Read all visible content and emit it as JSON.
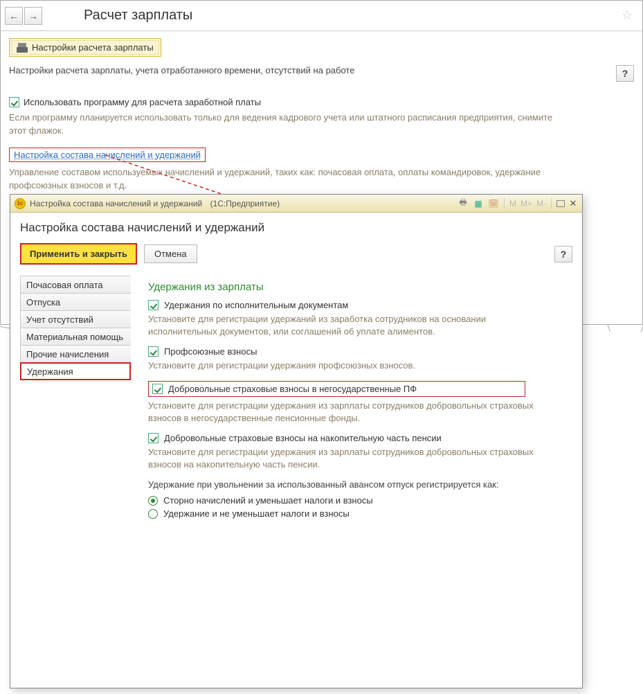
{
  "parent": {
    "title": "Расчет зарплаты",
    "print_button": "Настройки расчета зарплаты",
    "subtitle": "Настройки расчета зарплаты, учета отработанного времени, отсутствий на работе",
    "help": "?",
    "check1": "Использовать программу для расчета заработной платы",
    "hint1": "Если программу планируется использовать только для ведения кадрового учета или штатного расписания предприятия, снимите этот флажок.",
    "link": "Настройка состава начислений и удержаний",
    "hint2": "Управление составом используемых начислений и удержаний, таких как: почасовая оплата, оплаты командировок, удержание профсоюзных взносов и т.д."
  },
  "modal": {
    "window_title_prefix": "Настройка состава начислений и удержаний",
    "window_title_suffix": "(1С:Предприятие)",
    "heading": "Настройка состава начислений и удержаний",
    "apply": "Применить и закрыть",
    "cancel": "Отмена",
    "help": "?",
    "tb": {
      "m": "M",
      "mplus": "M+",
      "mminus": "M-"
    },
    "tabs": [
      {
        "label": "Почасовая оплата"
      },
      {
        "label": "Отпуска"
      },
      {
        "label": "Учет отсутствий"
      },
      {
        "label": "Материальная помощь"
      },
      {
        "label": "Прочие начисления"
      },
      {
        "label": "Удержания"
      }
    ],
    "panel": {
      "title": "Удержания из зарплаты",
      "options": [
        {
          "label": "Удержания по исполнительным документам",
          "hint": "Установите для регистрации удержаний из заработка сотрудников на основании исполнительных документов, или соглашений об уплате алиментов.",
          "checked": true,
          "highlight": false
        },
        {
          "label": "Профсоюзные взносы",
          "hint": "Установите для регистрации удержания профсоюзных взносов.",
          "checked": true,
          "highlight": false
        },
        {
          "label": "Добровольные страховые взносы в негосударственные ПФ",
          "hint": "Установите для регистрации удержания из зарплаты сотрудников добровольных страховых взносов в негосударственные пенсионные фонды.",
          "checked": true,
          "highlight": true
        },
        {
          "label": "Добровольные страховые взносы на накопительную часть пенсии",
          "hint": "Установите для регистрации удержания из зарплаты сотрудников добровольных страховых взносов на накопительную часть пенсии.",
          "checked": true,
          "highlight": false
        }
      ],
      "dismissal_label": "Удержание при увольнении за использованный авансом отпуск регистрируется как:",
      "radios": [
        {
          "label": "Сторно начислений и уменьшает налоги и взносы",
          "selected": true
        },
        {
          "label": "Удержание и не уменьшает налоги и взносы",
          "selected": false
        }
      ]
    }
  }
}
